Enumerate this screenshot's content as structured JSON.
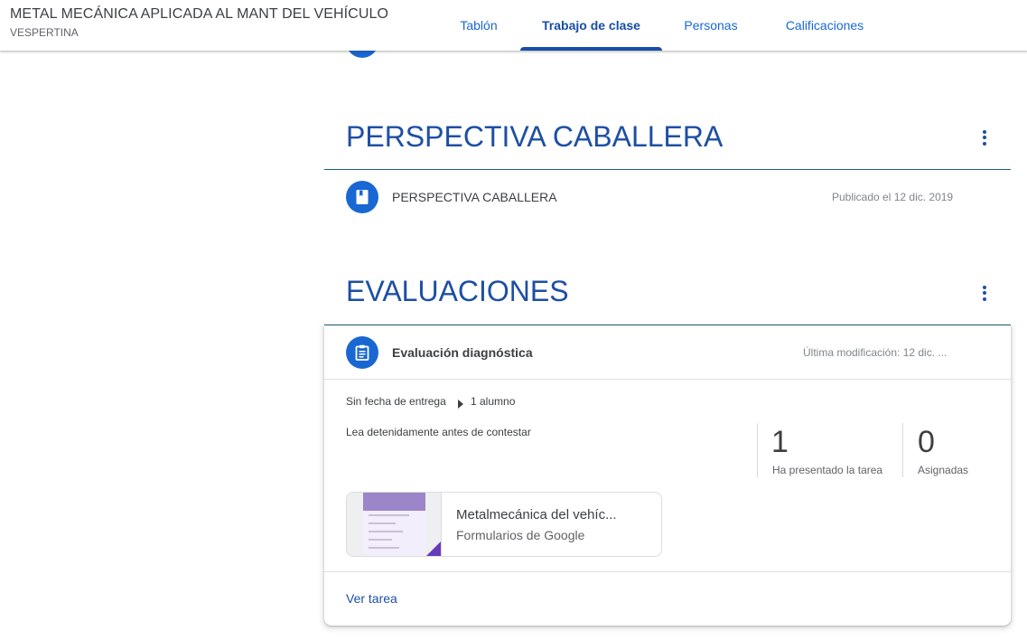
{
  "header": {
    "course_title": "METAL MECÁNICA APLICADA AL MANT DEL VEHÍCULO",
    "course_section": "VESPERTINA",
    "tabs": [
      {
        "label": "Tablón"
      },
      {
        "label": "Trabajo de clase",
        "active": true
      },
      {
        "label": "Personas"
      },
      {
        "label": "Calificaciones"
      }
    ]
  },
  "topics": [
    {
      "title": "PERSPECTIVA CABALLERA",
      "items": [
        {
          "icon": "book-icon",
          "title": "PERSPECTIVA CABALLERA",
          "meta": "Publicado el 12 dic. 2019"
        }
      ]
    },
    {
      "title": "EVALUACIONES",
      "items": [
        {
          "icon": "assignment-icon",
          "title": "Evaluación diagnóstica",
          "meta": "Última modificación: 12 dic. ...",
          "due": "Sin fecha de entrega",
          "assignees": "1 alumno",
          "description": "Lea detenidamente antes de contestar",
          "stats": [
            {
              "value": "1",
              "label": "Ha presentado la tarea"
            },
            {
              "value": "0",
              "label": "Asignadas"
            }
          ],
          "attachment": {
            "title": "Metalmecánica del vehíc...",
            "subtitle": "Formularios de Google"
          },
          "link": "Ver tarea"
        }
      ]
    }
  ],
  "colors": {
    "accent": "#1967d2",
    "topic_title": "#1e4fa3",
    "active_tab": "#174ea6",
    "divider": "#1b5e6e",
    "forms_purple": "#673ab7"
  }
}
